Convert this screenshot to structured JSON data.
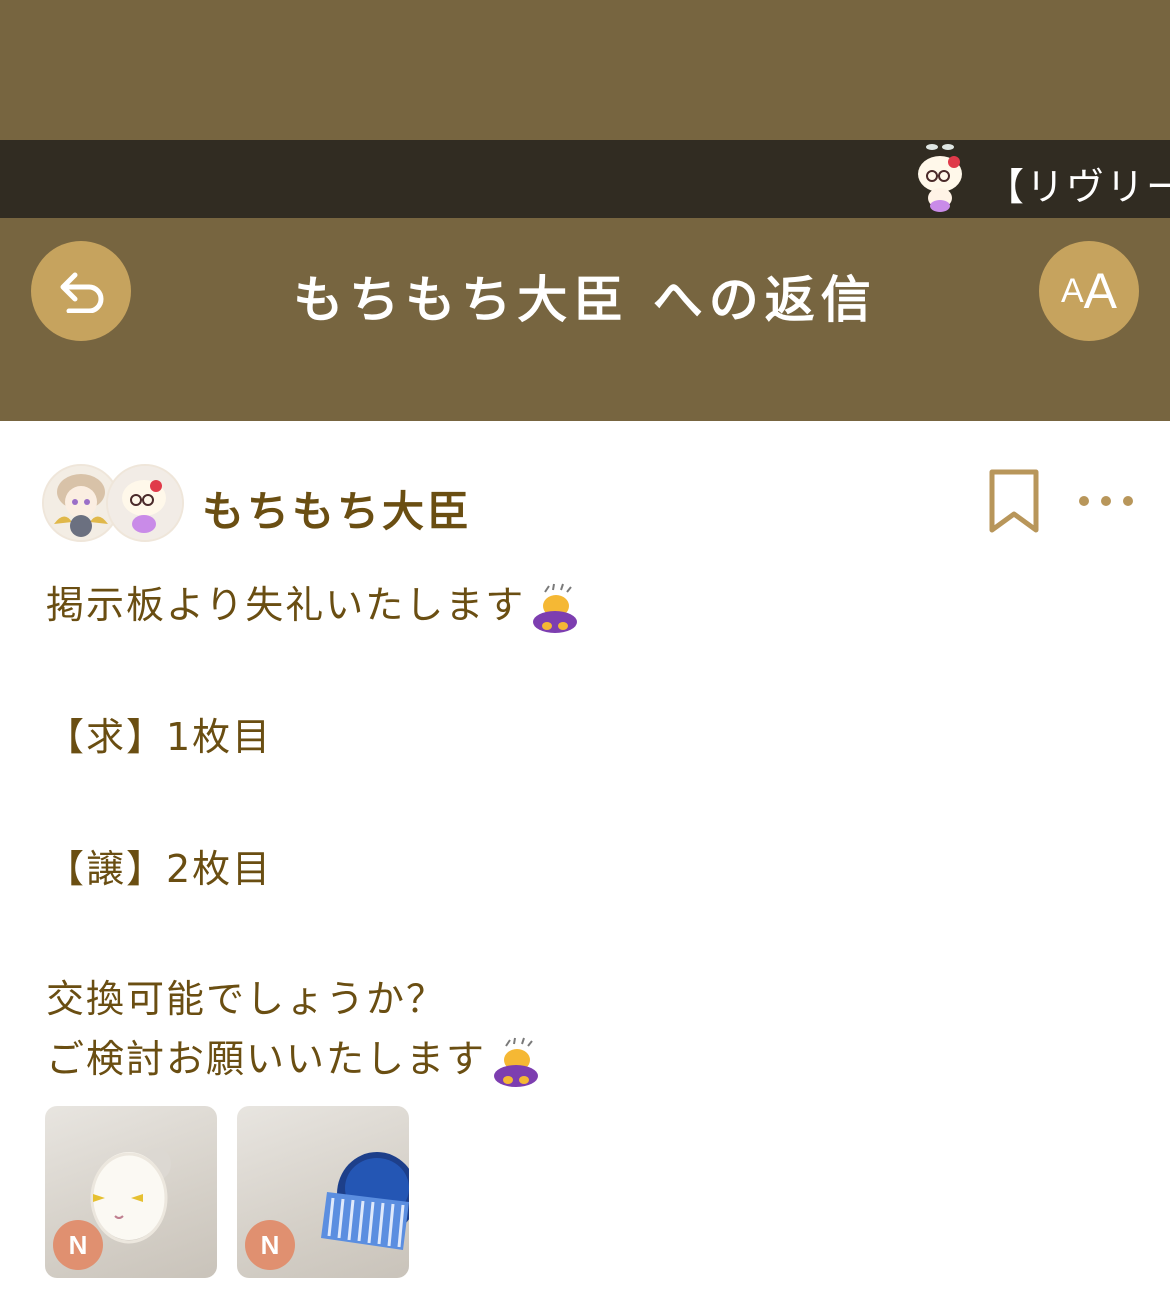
{
  "ticker": {
    "text": "【リヴリー"
  },
  "header": {
    "title": "もちもち大臣 への返信",
    "font_size_button": {
      "big": "A",
      "small": "A"
    }
  },
  "post": {
    "username": "もちもち大臣",
    "lines": [
      "掲示板より失礼いたします",
      "【求】1枚目",
      "【譲】2枚目",
      "交換可能でしょうか？",
      "ご検討お願いいたします"
    ],
    "attachments": [
      {
        "badge": "N",
        "item": "cat-egg-item"
      },
      {
        "badge": "N",
        "item": "blue-hat-item"
      }
    ]
  },
  "colors": {
    "header_bg": "#776540",
    "ticker_bg": "#312c22",
    "button_gold": "#c6a35e",
    "text_brown": "#6a4e12",
    "badge": "#e09070"
  }
}
